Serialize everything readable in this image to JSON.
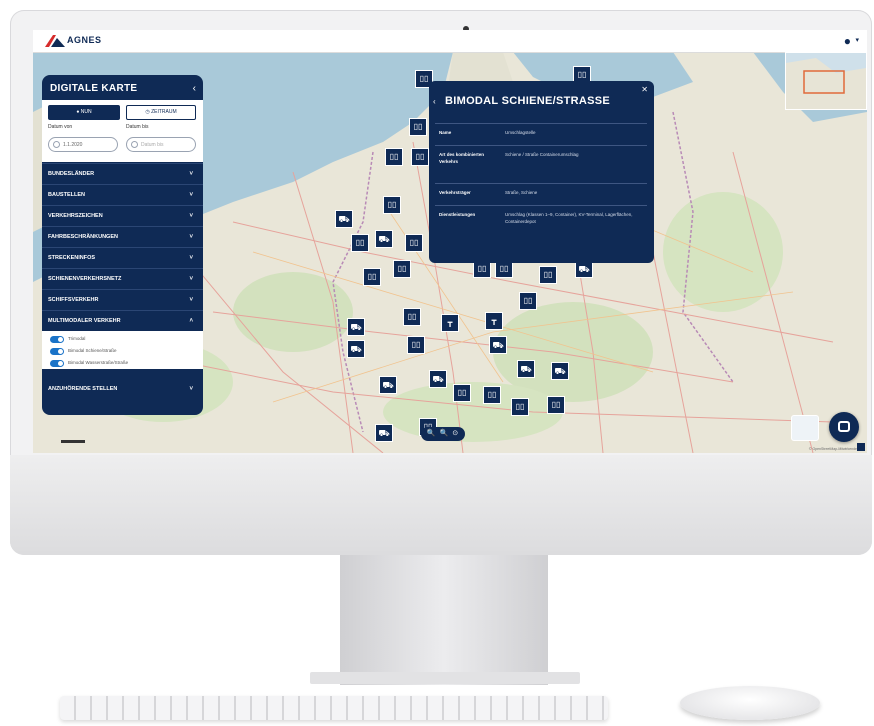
{
  "app": {
    "logo_text": "AGNES",
    "account_icon": "account-circle-icon"
  },
  "sidebar": {
    "title": "DIGITALE KARTE",
    "time_buttons": {
      "now": "● NUN",
      "range": "◷ ZEITRAUM"
    },
    "date_from_label": "Datum von",
    "date_to_label": "Datum bis",
    "date_from_value": "1.1.2020",
    "date_to_value": "Datum bis",
    "layers": [
      "BUNDESLÄNDER",
      "BAUSTELLEN",
      "VERKEHRSZEICHEN",
      "FAHRBESCHRÄNKUNGEN",
      "STRECKENINFOS",
      "SCHIENENVERKEHRSNETZ",
      "SCHIFFSVERKEHR",
      "MULTIMODALER VERKEHR"
    ],
    "multimodal_toggles": [
      "Trimodal",
      "Bimodal Schiene/Straße",
      "Bimodal Wasserstraße/Straße"
    ],
    "last_layer": "ANZUHÖRENDE STELLEN"
  },
  "popup": {
    "title": "BIMODAL SCHIENE/STRASSE",
    "rows": [
      {
        "key": "Name",
        "value": "Umschlagstelle"
      },
      {
        "key": "Art des kombinierten Verkehrs",
        "value": "Schiene / Straße Containerumschlag"
      },
      {
        "key": "Verkehrsträger",
        "value": "Straße, Schiene"
      },
      {
        "key": "Dienstleistungen",
        "value": "Umschlag (Klassen 1–9, Container), KV-Terminal, Lagerflächen, Containerdepot"
      }
    ]
  },
  "map": {
    "zoom_controls": "🔍 🔍 ⊙",
    "attribution": "© OpenStreetMap-Mitwirkende",
    "colors": {
      "sea": "#a9c9d9",
      "land": "#e7e4d6",
      "forest": "#cfe0b8",
      "marker": "#0f2a55",
      "road": "#e8a6a0",
      "accent": "#0f2a55"
    }
  }
}
